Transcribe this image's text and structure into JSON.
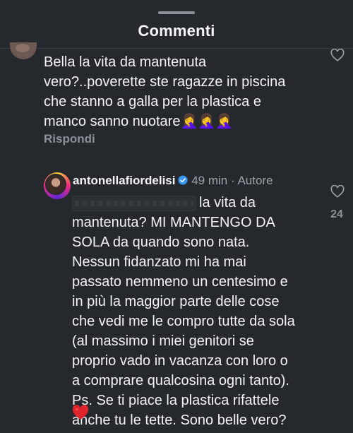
{
  "header": {
    "title": "Commenti"
  },
  "comments": [
    {
      "text": "Bella la vita da mantenuta\nvero?..poverette ste ragazze in piscina\nche stanno a galla per la plastica e\nmanco sanno nuotare🤦‍♀️🤦‍♀️🤦‍♀️",
      "reply_label": "Rispondi"
    },
    {
      "username": "antonellafiordelisi",
      "time": "49 min",
      "separator": "·",
      "badge": "Autore",
      "text": "la vita da\nmantenuta? MI MANTENGO DA\nSOLA da quando sono nata.\nNessun fidanzato mi ha mai\npassato nemmeno un centesimo e\nin più la maggior parte delle cose\nche vedi me le compro tutte da sola\n(al massimo i miei genitori se\nproprio vado in vacanza con loro o\na comprare qualcosina ogni tanto).\nPs. Se ti piace la plastica rifattele\nanche tu le tette. Sono belle vero?",
      "likes": "24"
    }
  ],
  "icons": {
    "like": "heart-outline-icon",
    "verified": "verified-badge-icon",
    "emoji": "red-heart-emoji"
  },
  "colors": {
    "background": "#25292e",
    "verified_blue": "#3897f0",
    "heart_red": "#e0242b"
  }
}
